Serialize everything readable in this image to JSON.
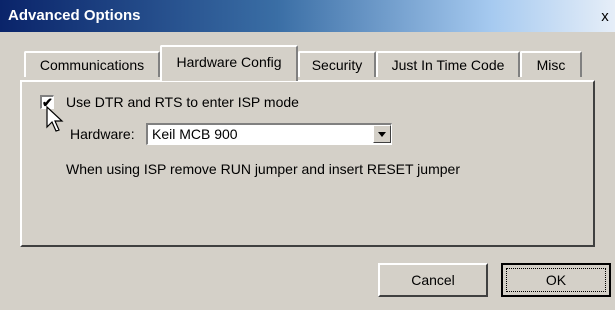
{
  "window": {
    "title": "Advanced Options",
    "close_glyph": "x"
  },
  "tabs": [
    {
      "label": "Communications",
      "active": false
    },
    {
      "label": "Hardware Config",
      "active": true
    },
    {
      "label": "Security",
      "active": false
    },
    {
      "label": "Just In Time Code",
      "active": false
    },
    {
      "label": "Misc",
      "active": false
    }
  ],
  "hardware_config": {
    "isp_checkbox": {
      "label": "Use DTR and RTS to enter ISP mode",
      "checked": true,
      "check_glyph": "✔"
    },
    "hardware_label": "Hardware:",
    "hardware_select": {
      "value": "Keil MCB 900"
    },
    "note": "When using ISP remove RUN jumper and insert RESET jumper"
  },
  "buttons": {
    "cancel": "Cancel",
    "ok": "OK"
  },
  "icons": {
    "cursor": "mouse-pointer-icon",
    "dropdown": "chevron-down-icon",
    "check": "checkmark-icon"
  }
}
